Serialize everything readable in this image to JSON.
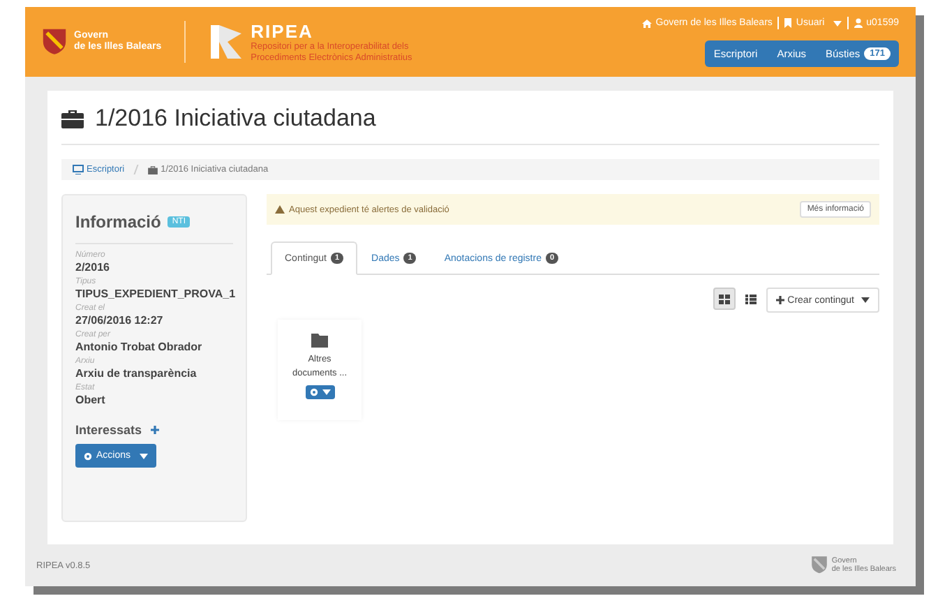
{
  "header": {
    "org_name_line1": "Govern",
    "org_name_line2": "de les Illes Balears",
    "app_name": "RIPEA",
    "app_subtitle_line1": "Repositori per a la Interoperabilitat dels",
    "app_subtitle_line2": "Procediments Electrònics Administratius",
    "top_links": [
      {
        "label": "Govern de les Illes Balears",
        "kind": "home"
      },
      {
        "label": "Usuari",
        "kind": "bookmark"
      },
      {
        "label": "u01599",
        "kind": "user"
      }
    ],
    "nav": [
      {
        "label": "Escriptori"
      },
      {
        "label": "Arxius"
      },
      {
        "label": "Bústies",
        "badge": "171"
      }
    ]
  },
  "page": {
    "title": "1/2016 Iniciativa ciutadana",
    "breadcrumb": [
      {
        "label": "Escriptori",
        "kind": "link"
      },
      {
        "label": "1/2016 Iniciativa ciutadana",
        "kind": "current"
      }
    ],
    "info": {
      "title": "Informació",
      "badge": "NTI",
      "fields": [
        {
          "label": "Número",
          "value": "2/2016"
        },
        {
          "label": "Tipus",
          "value": "TIPUS_EXPEDIENT_PROVA_1"
        },
        {
          "label": "Creat el",
          "value": "27/06/2016 12:27"
        },
        {
          "label": "Creat per",
          "value": "Antonio Trobat Obrador"
        },
        {
          "label": "Arxiu",
          "value": "Arxiu de transparència"
        },
        {
          "label": "Estat",
          "value": "Obert"
        }
      ],
      "interessats": "Interessats",
      "actions_button": "Accions"
    },
    "alert": {
      "text": "Aquest expedient té alertes de validació",
      "button": "Més informació"
    },
    "tabs": [
      {
        "label": "Contingut",
        "count": "1",
        "selected": true
      },
      {
        "label": "Dades",
        "count": "1",
        "selected": false
      },
      {
        "label": "Anotacions de registre",
        "count": "0",
        "selected": false
      }
    ],
    "view_modes": [
      {
        "kind": "grid",
        "selected": true
      },
      {
        "kind": "list",
        "selected": false
      }
    ],
    "create_button": "Crear contingut",
    "items": [
      {
        "name_line1": "Altres",
        "name_line2": "documents ..."
      }
    ]
  },
  "footer": {
    "version": "RIPEA v0.8.5",
    "logo_line1": "Govern",
    "logo_line2": "de les Illes Balears"
  }
}
